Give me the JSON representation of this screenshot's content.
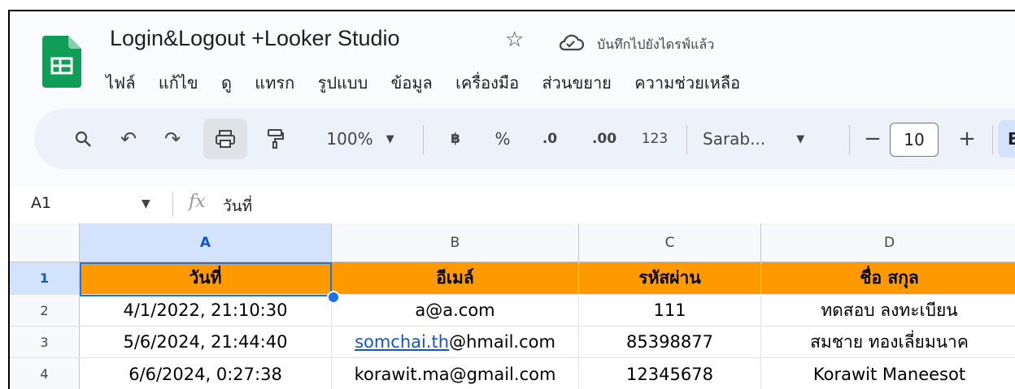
{
  "doc": {
    "title": "Login&Logout +Looker Studio",
    "save_status": "บันทึกไปยังไดรฟ์แล้ว"
  },
  "menu": [
    "ไฟล์",
    "แก้ไข",
    "ดู",
    "แทรก",
    "รูปแบบ",
    "ข้อมูล",
    "เครื่องมือ",
    "ส่วนขยาย",
    "ความช่วยเหลือ"
  ],
  "toolbar": {
    "zoom": "100%",
    "currency": "฿",
    "percent": "%",
    "dec_decrease": ".0",
    "dec_increase": ".00",
    "number_format": "123",
    "font": "Sarab...",
    "font_size": "10",
    "minus": "−",
    "plus": "+",
    "bold": "B"
  },
  "formula_bar": {
    "cell_ref": "A1",
    "fx": "fx",
    "value": "วันที่"
  },
  "sheet": {
    "columns": [
      "A",
      "B",
      "C",
      "D"
    ],
    "rows": [
      {
        "num": "1",
        "cells": [
          "วันที่",
          "อีเมล์",
          "รหัสผ่าน",
          "ชื่อ สกุล"
        ]
      },
      {
        "num": "2",
        "cells": [
          "4/1/2022, 21:10:30",
          "a@a.com",
          "111",
          "ทดสอบ ลงทะเบียน"
        ]
      },
      {
        "num": "3",
        "cells": [
          "5/6/2024, 21:44:40",
          "somchai.th@hmail.com",
          "85398877",
          "สมชาย ทองเลี่ยมนาค"
        ],
        "email_link": "somchai.th",
        "email_rest": "@hmail.com"
      },
      {
        "num": "4",
        "cells": [
          "6/6/2024, 0:27:38",
          "korawit.ma@gmail.com",
          "12345678",
          "Korawit Maneesot"
        ]
      }
    ]
  },
  "colors": {
    "header_fill": "#ff9900",
    "selection": "#1a73e8",
    "sheets_green": "#0f9d58"
  }
}
